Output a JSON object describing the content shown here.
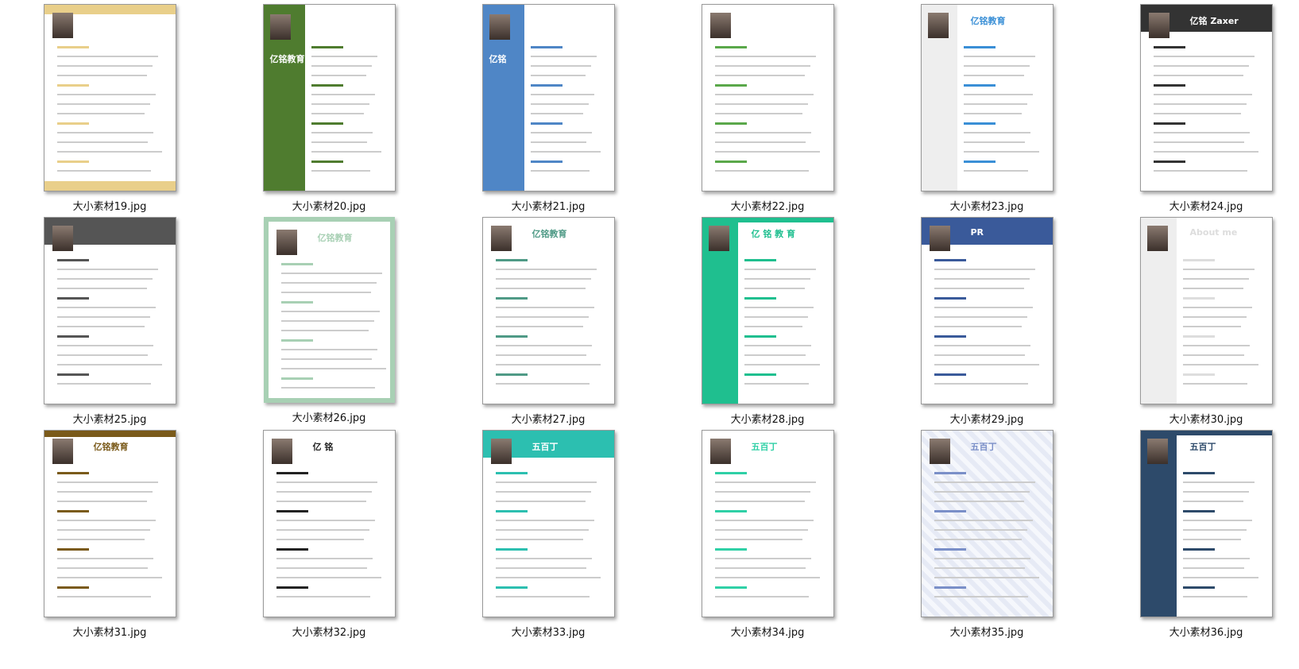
{
  "files": [
    {
      "name": "大小素材19.jpg",
      "accent": "#e9cf8a",
      "layout": "wave",
      "title": ""
    },
    {
      "name": "大小素材20.jpg",
      "accent": "#4f7c2f",
      "layout": "side",
      "title": "亿铭教育"
    },
    {
      "name": "大小素材21.jpg",
      "accent": "#4f86c6",
      "layout": "side",
      "title": "亿铭"
    },
    {
      "name": "大小素材22.jpg",
      "accent": "#5aa84a",
      "layout": "plain",
      "title": ""
    },
    {
      "name": "大小素材23.jpg",
      "accent": "#3a8fd6",
      "layout": "side-light",
      "title": "亿铭教育"
    },
    {
      "name": "大小素材24.jpg",
      "accent": "#333333",
      "layout": "top",
      "title": "亿铭 Zaxer"
    },
    {
      "name": "大小素材25.jpg",
      "accent": "#555555",
      "layout": "top",
      "title": ""
    },
    {
      "name": "大小素材26.jpg",
      "accent": "#a8d0b4",
      "layout": "frame",
      "title": "亿铭教育"
    },
    {
      "name": "大小素材27.jpg",
      "accent": "#4f9a86",
      "layout": "plain",
      "title": "亿铭教育"
    },
    {
      "name": "大小素材28.jpg",
      "accent": "#1fbf8f",
      "layout": "side-dark",
      "title": "亿 铭 教 育"
    },
    {
      "name": "大小素材29.jpg",
      "accent": "#3a5a9a",
      "layout": "top",
      "title": "PR"
    },
    {
      "name": "大小素材30.jpg",
      "accent": "#dddddd",
      "layout": "side-light",
      "title": "About me"
    },
    {
      "name": "大小素材31.jpg",
      "accent": "#7a5a1a",
      "layout": "top-thin",
      "title": "亿铭教育"
    },
    {
      "name": "大小素材32.jpg",
      "accent": "#222222",
      "layout": "plain",
      "title": "亿 铭"
    },
    {
      "name": "大小素材33.jpg",
      "accent": "#2cbfb0",
      "layout": "top",
      "title": "五百丁"
    },
    {
      "name": "大小素材34.jpg",
      "accent": "#2fd0a6",
      "layout": "plain",
      "title": "五百丁"
    },
    {
      "name": "大小素材35.jpg",
      "accent": "#7a8fc8",
      "layout": "pattern",
      "title": "五百丁"
    },
    {
      "name": "大小素材36.jpg",
      "accent": "#2d4a6a",
      "layout": "side-dark",
      "title": "五百丁"
    }
  ]
}
